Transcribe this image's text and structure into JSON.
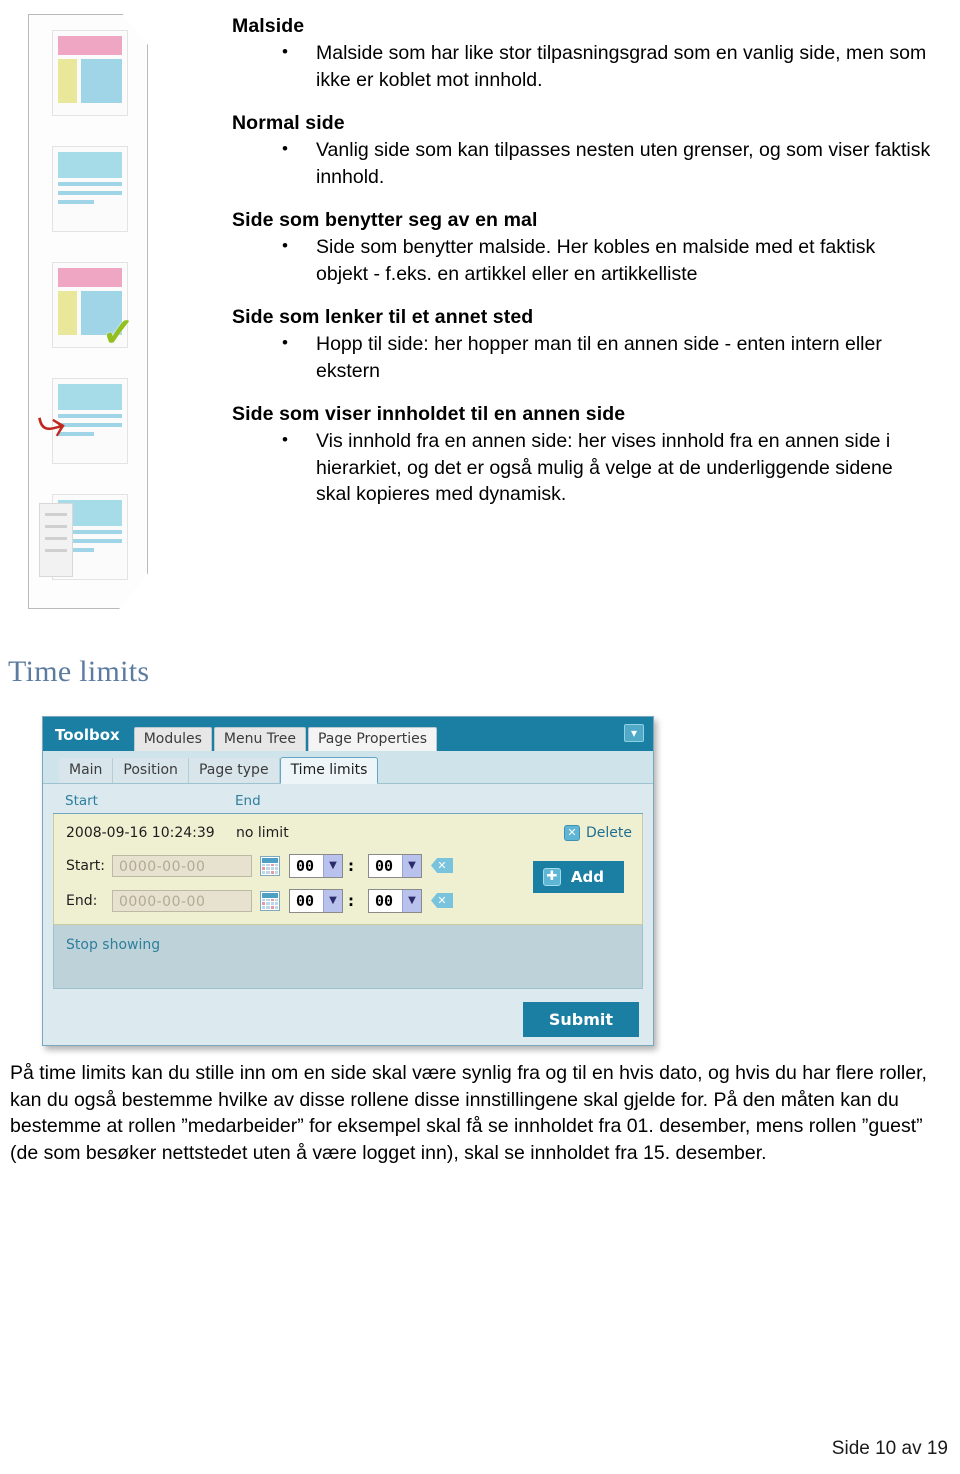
{
  "illustration": {
    "alt": "page-type-illustration-strip",
    "items": [
      {
        "name": "template-page-thumb"
      },
      {
        "name": "normal-page-thumb"
      },
      {
        "name": "page-using-template-thumb"
      },
      {
        "name": "jump-to-page-thumb"
      },
      {
        "name": "show-content-from-page-thumb"
      }
    ]
  },
  "sections": [
    {
      "title": "Malside",
      "bullets": [
        "Malside som har like stor tilpasningsgrad som en vanlig side, men som ikke er koblet mot innhold."
      ]
    },
    {
      "title": "Normal side",
      "bullets": [
        "Vanlig side som kan tilpasses nesten uten grenser, og som viser faktisk innhold."
      ]
    },
    {
      "title": "Side som benytter seg av en mal",
      "bullets": [
        "Side som benytter malside. Her kobles en malside med et faktisk objekt - f.eks. en artikkel eller en artikkelliste"
      ]
    },
    {
      "title": "Side som lenker til et annet sted",
      "bullets": [
        "Hopp til side: her hopper man til en annen side - enten intern eller ekstern"
      ]
    },
    {
      "title": "Side som viser innholdet til en annen side",
      "bullets": [
        "Vis innhold fra en annen side: her vises innhold fra en annen side i hierarkiet, og det er også mulig å velge at de underliggende sidene skal kopieres med dynamisk."
      ]
    }
  ],
  "time_limits_heading": "Time limits",
  "toolbox": {
    "title": "Toolbox",
    "top_tabs": [
      "Modules",
      "Menu Tree",
      "Page Properties"
    ],
    "minimize_icon": "collapse-icon",
    "sub_tabs": [
      "Main",
      "Position",
      "Page type",
      "Time limits"
    ],
    "active_sub_tab": "Time limits",
    "columns": {
      "start": "Start",
      "end": "End"
    },
    "entry": {
      "start_value": "2008-09-16 10:24:39",
      "end_value": "no limit",
      "delete_label": "Delete"
    },
    "start_field": {
      "label": "Start:",
      "placeholder": "0000-00-00",
      "hour": "00",
      "minute": "00",
      "separator": ":"
    },
    "end_field": {
      "label": "End:",
      "placeholder": "0000-00-00",
      "hour": "00",
      "minute": "00",
      "separator": ":"
    },
    "add_label": "Add",
    "stop_showing_label": "Stop showing",
    "submit_label": "Submit",
    "colors": {
      "header_teal": "#1b7fa3",
      "panel_bg": "#dce9ef",
      "entry_bg": "#eff0d2",
      "stop_bg": "#bed3d9",
      "link_blue": "#2e7e9e"
    }
  },
  "closing_paragraph": "På time limits kan du stille inn om en side skal være synlig fra og til en hvis dato, og hvis du har flere roller, kan du også bestemme hvilke av disse rollene disse innstillingene skal gjelde for. På den måten kan du bestemme at rollen ”medarbeider” for eksempel skal få se innholdet fra 01. desember, mens rollen ”guest” (de som besøker nettstedet uten å være logget inn), skal se innholdet fra 15. desember.",
  "footer": "Side 10 av 19"
}
